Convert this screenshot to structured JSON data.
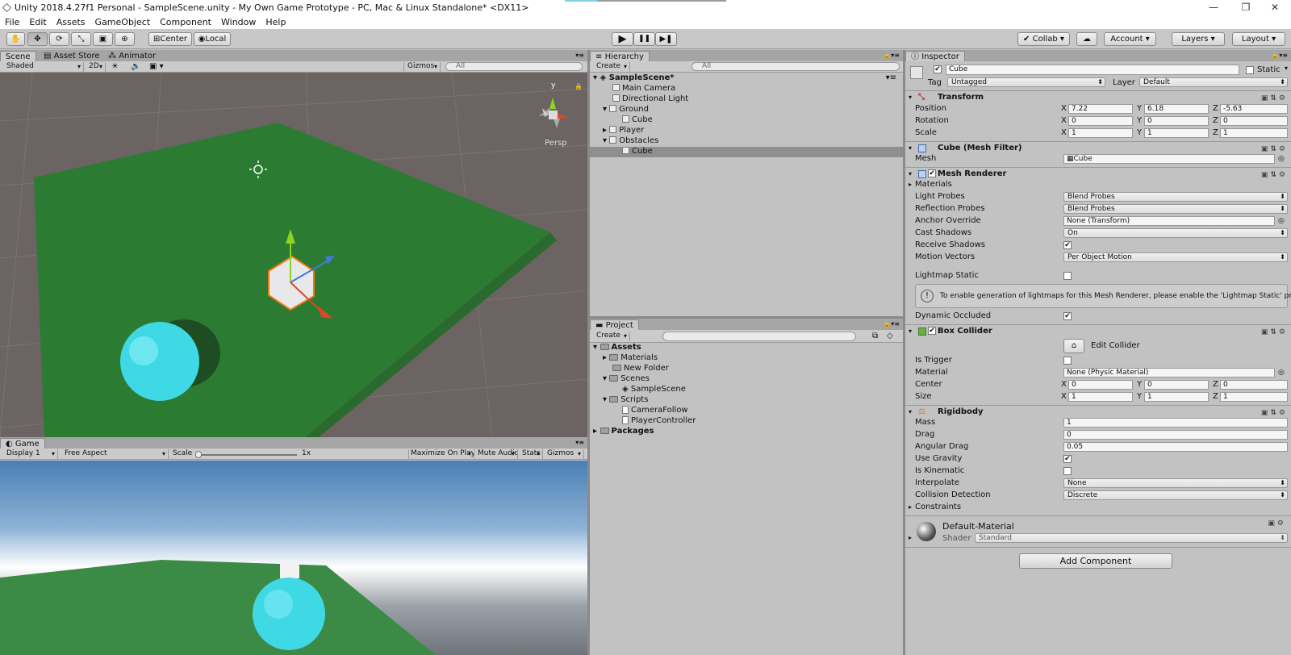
{
  "window": {
    "title": "Unity 2018.4.27f1 Personal - SampleScene.unity - My Own Game Prototype - PC, Mac & Linux Standalone* <DX11>",
    "min": "—",
    "max": "❐",
    "close": "✕"
  },
  "menu": [
    "File",
    "Edit",
    "Assets",
    "GameObject",
    "Component",
    "Window",
    "Help"
  ],
  "toolbar": {
    "tools": [
      "hand-icon",
      "move-icon",
      "rotate-icon",
      "scale-icon",
      "rect-icon",
      "transform-icon"
    ],
    "pivot": "Center",
    "space": "Local",
    "collab": "Collab",
    "account": "Account",
    "layers": "Layers",
    "layout": "Layout",
    "play": "▶",
    "pause": "❚❚",
    "step": "▶❚"
  },
  "scene": {
    "tabs": [
      "Scene",
      "Asset Store",
      "Animator"
    ],
    "shading": "Shaded",
    "mode2d": "2D",
    "gizmos": "Gizmos",
    "search": "All",
    "persp": "Persp",
    "gizmo_y": "y"
  },
  "game": {
    "tab": "Game",
    "display": "Display 1",
    "aspect": "Free Aspect",
    "scale_label": "Scale",
    "scale_val": "1x",
    "maximize": "Maximize On Play",
    "mute": "Mute Audio",
    "stats": "Stats",
    "gizmos": "Gizmos"
  },
  "hierarchy": {
    "tab": "Hierarchy",
    "create": "Create",
    "search": "All",
    "scene": "SampleScene*",
    "items": [
      {
        "label": "Main Camera"
      },
      {
        "label": "Directional Light"
      },
      {
        "label": "Ground"
      },
      {
        "label": "Cube"
      },
      {
        "label": "Player"
      },
      {
        "label": "Obstacles"
      },
      {
        "label": "Cube"
      }
    ]
  },
  "project": {
    "tab": "Project",
    "create": "Create",
    "items": [
      {
        "label": "Assets"
      },
      {
        "label": "Materials"
      },
      {
        "label": "New Folder"
      },
      {
        "label": "Scenes"
      },
      {
        "label": "SampleScene"
      },
      {
        "label": "Scripts"
      },
      {
        "label": "CameraFollow"
      },
      {
        "label": "PlayerController"
      },
      {
        "label": "Packages"
      }
    ]
  },
  "inspector": {
    "tab": "Inspector",
    "name": "Cube",
    "static": "Static",
    "tag_label": "Tag",
    "tag": "Untagged",
    "layer_label": "Layer",
    "layer": "Default",
    "transform": {
      "title": "Transform",
      "position_label": "Position",
      "rotation_label": "Rotation",
      "scale_label": "Scale",
      "position": [
        "7.22",
        "6.18",
        "-5.63"
      ],
      "rotation": [
        "0",
        "0",
        "0"
      ],
      "scale": [
        "1",
        "1",
        "1"
      ]
    },
    "meshfilter": {
      "title": "Cube (Mesh Filter)",
      "mesh_label": "Mesh",
      "mesh": "Cube"
    },
    "meshrenderer": {
      "title": "Mesh Renderer",
      "materials": "Materials",
      "light_probes_label": "Light Probes",
      "light_probes": "Blend Probes",
      "reflection_probes_label": "Reflection Probes",
      "reflection_probes": "Blend Probes",
      "anchor_label": "Anchor Override",
      "anchor": "None (Transform)",
      "cast_label": "Cast Shadows",
      "cast": "On",
      "receive_label": "Receive Shadows",
      "motion_label": "Motion Vectors",
      "motion": "Per Object Motion",
      "lightmap_label": "Lightmap Static",
      "info": "To enable generation of lightmaps for this Mesh Renderer, please enable the 'Lightmap Static' property.",
      "occluded_label": "Dynamic Occluded"
    },
    "boxcollider": {
      "title": "Box Collider",
      "edit": "Edit Collider",
      "trigger_label": "Is Trigger",
      "material_label": "Material",
      "material": "None (Physic Material)",
      "center_label": "Center",
      "center": [
        "0",
        "0",
        "0"
      ],
      "size_label": "Size",
      "size": [
        "1",
        "1",
        "1"
      ]
    },
    "rigidbody": {
      "title": "Rigidbody",
      "mass_label": "Mass",
      "mass": "1",
      "drag_label": "Drag",
      "drag": "0",
      "angular_label": "Angular Drag",
      "angular": "0.05",
      "gravity_label": "Use Gravity",
      "kinematic_label": "Is Kinematic",
      "interp_label": "Interpolate",
      "interp": "None",
      "collision_label": "Collision Detection",
      "collision": "Discrete",
      "constraints": "Constraints"
    },
    "material": {
      "name": "Default-Material",
      "shader_label": "Shader",
      "shader": "Standard"
    },
    "add_component": "Add Component"
  }
}
